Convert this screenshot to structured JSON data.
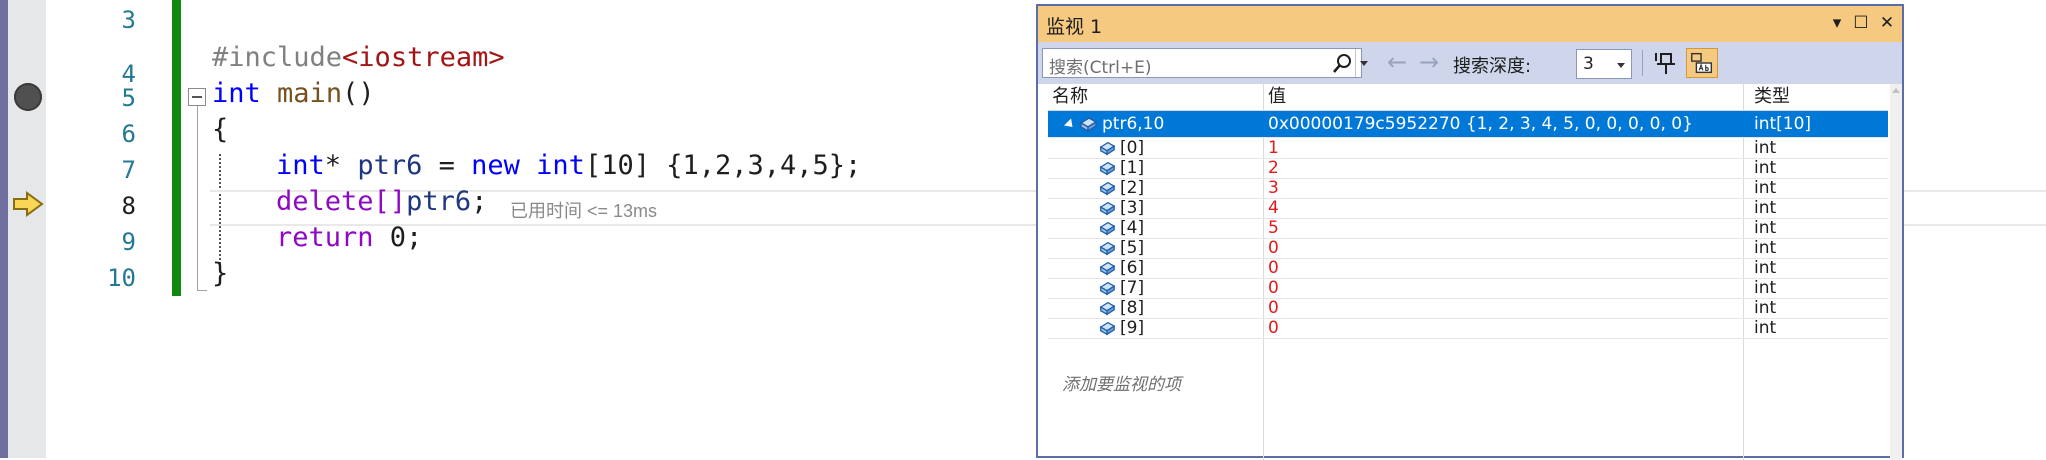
{
  "editor": {
    "line_numbers": [
      "3",
      "4",
      "5",
      "6",
      "7",
      "8",
      "9",
      "10"
    ],
    "current_line": "8",
    "lines": [
      {
        "line": "3",
        "code": ""
      },
      {
        "line": "4",
        "code": "#include<iostream>"
      },
      {
        "line": "5",
        "code": "int main()"
      },
      {
        "line": "6",
        "code": "{"
      },
      {
        "line": "7",
        "code": "int* ptr6 = new int[10] {1,2,3,4,5};"
      },
      {
        "line": "8",
        "code": "delete[]ptr6;"
      },
      {
        "line": "9",
        "code": "return 0;"
      },
      {
        "line": "10",
        "code": "}"
      }
    ],
    "tokens": {
      "l4_directive": "#include",
      "l4_header": "<iostream>",
      "l5_type": "int",
      "l5_fn": "main",
      "l5_parens": "()",
      "l6_brace": "{",
      "l7_type": "int",
      "l7_star": "*",
      "l7_var": "ptr6",
      "l7_eq": " = ",
      "l7_new": "new",
      "l7_type2": "int",
      "l7_rest": "[10] {1,2,3,4,5};",
      "l8_delete": "delete",
      "l8_brackets": "[]",
      "l8_var": "ptr6",
      "l8_semi": ";",
      "l9_return": "return",
      "l9_rest": " 0;",
      "l10_brace": "}"
    },
    "perf_tip": "已用时间 <= 13ms"
  },
  "watch": {
    "title": "监视 1",
    "title_buttons": {
      "dropdown": "▾",
      "maximize": "☐",
      "close": "✕"
    },
    "search_placeholder": "搜索(Ctrl+E)",
    "back_arrow": "←",
    "forward_arrow": "→",
    "depth_label": "搜索深度:",
    "depth_value": "3",
    "columns": {
      "name": "名称",
      "value": "值",
      "type": "类型"
    },
    "root": {
      "name": "ptr6,10",
      "value": "0x00000179c5952270 {1, 2, 3, 4, 5, 0, 0, 0, 0, 0}",
      "type": "int[10]"
    },
    "items": [
      {
        "name": "[0]",
        "value": "1",
        "type": "int"
      },
      {
        "name": "[1]",
        "value": "2",
        "type": "int"
      },
      {
        "name": "[2]",
        "value": "3",
        "type": "int"
      },
      {
        "name": "[3]",
        "value": "4",
        "type": "int"
      },
      {
        "name": "[4]",
        "value": "5",
        "type": "int"
      },
      {
        "name": "[5]",
        "value": "0",
        "type": "int"
      },
      {
        "name": "[6]",
        "value": "0",
        "type": "int"
      },
      {
        "name": "[7]",
        "value": "0",
        "type": "int"
      },
      {
        "name": "[8]",
        "value": "0",
        "type": "int"
      },
      {
        "name": "[9]",
        "value": "0",
        "type": "int"
      }
    ],
    "add_watch_text": "添加要监视的项"
  },
  "colors": {
    "change_bar": "#0f8a0f",
    "selection": "#0078d7",
    "watch_title_bg": "#f6c980",
    "toolbar_bg": "#cfd6ec",
    "changed_value": "#e21a1a"
  },
  "icons": [
    "breakpoint-icon",
    "execution-arrow-icon",
    "search-icon",
    "pin-icon",
    "hex-display-icon",
    "object-icon"
  ]
}
